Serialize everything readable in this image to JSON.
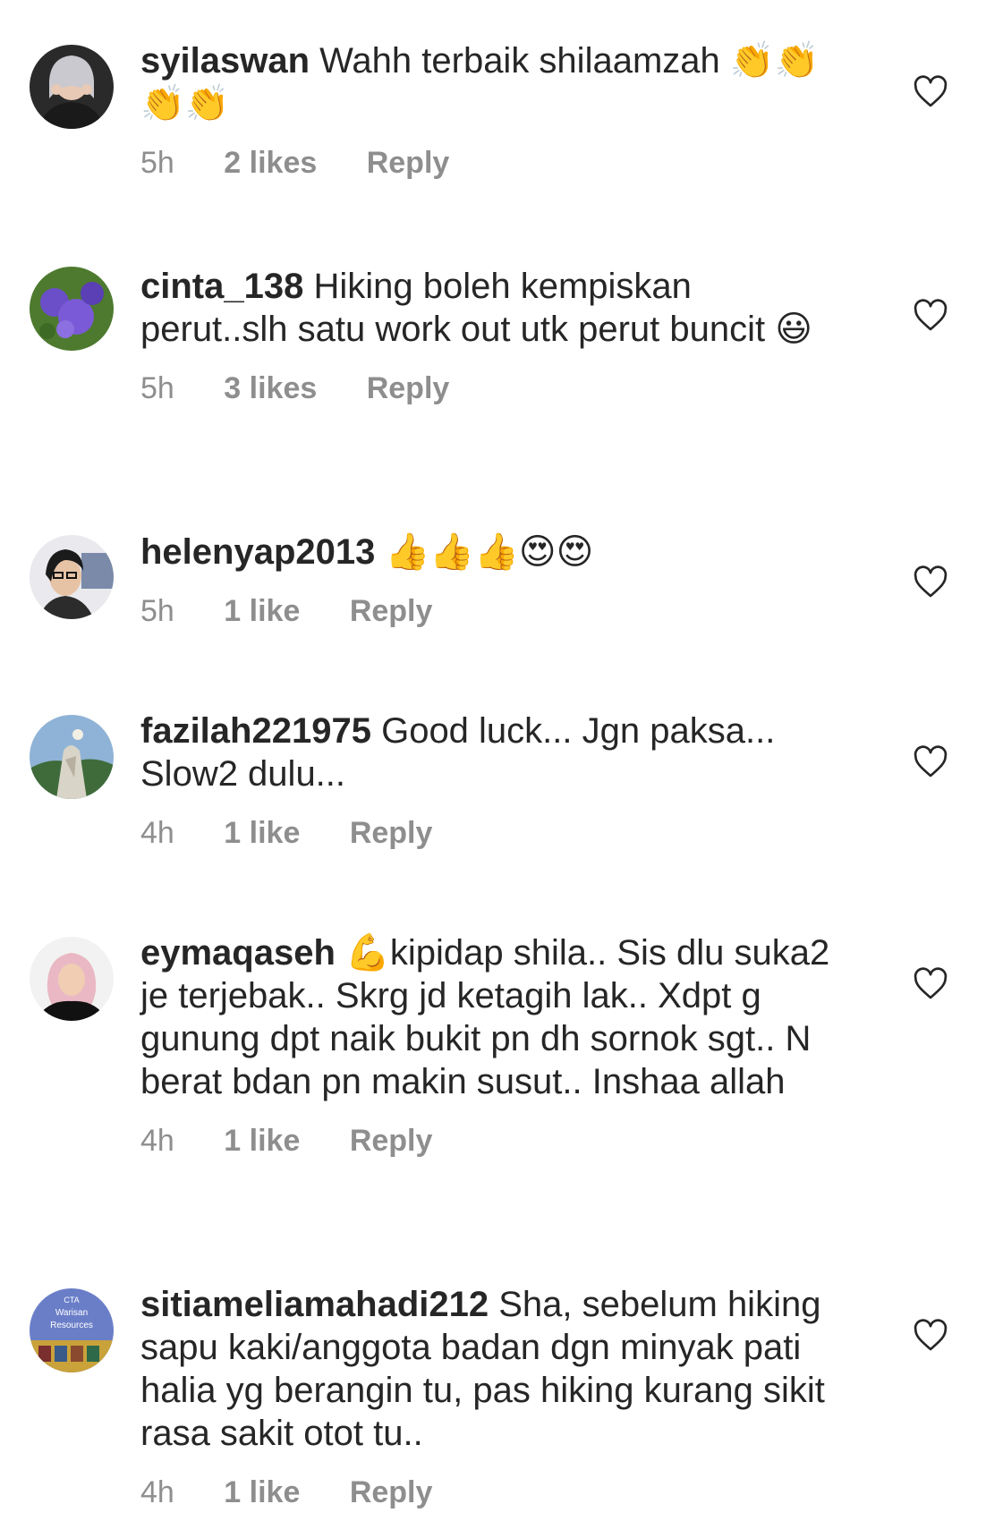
{
  "comments": [
    {
      "username": "syilaswan",
      "text": "Wahh terbaik shilaamzah 👏👏👏👏",
      "time": "5h",
      "likes": "2 likes",
      "reply": "Reply"
    },
    {
      "username": "cinta_138",
      "text": "Hiking boleh kempiskan perut..slh satu work out utk perut buncit 😃",
      "time": "5h",
      "likes": "3 likes",
      "reply": "Reply"
    },
    {
      "username": "helenyap2013",
      "text": "👍👍👍😍😍",
      "time": "5h",
      "likes": "1 like",
      "reply": "Reply"
    },
    {
      "username": "fazilah221975",
      "text": "Good luck... Jgn paksa... Slow2 dulu...",
      "time": "4h",
      "likes": "1 like",
      "reply": "Reply"
    },
    {
      "username": "eymaqaseh",
      "text": "💪kipidap shila.. Sis dlu suka2 je terjebak.. Skrg jd ketagih lak.. Xdpt g gunung dpt naik bukit pn dh sornok sgt.. N berat bdan pn makin susut.. Inshaa allah",
      "time": "4h",
      "likes": "1 like",
      "reply": "Reply"
    },
    {
      "username": "sitiameliamahadi212",
      "text": "Sha, sebelum hiking sapu kaki/anggota badan dgn minyak pati halia yg berangin tu, pas hiking kurang sikit rasa sakit otot tu..",
      "time": "4h",
      "likes": "1 like",
      "reply": "Reply",
      "avatar_text": [
        "CTA",
        "Warisan",
        "Resources"
      ]
    }
  ],
  "icons": {
    "like": "heart-outline-icon"
  },
  "colors": {
    "text": "#262626",
    "meta": "#8e8e8e",
    "background": "#ffffff"
  }
}
